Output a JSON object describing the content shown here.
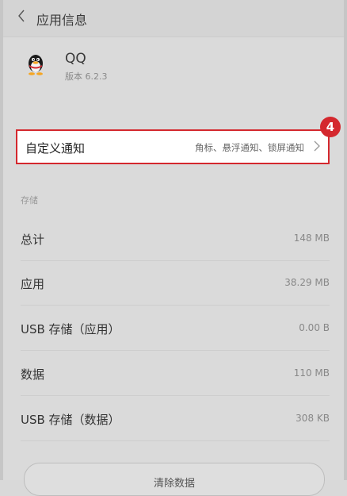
{
  "header": {
    "title": "应用信息"
  },
  "app": {
    "name": "QQ",
    "version": "版本 6.2.3"
  },
  "notification": {
    "label": "自定义通知",
    "value": "角标、悬浮通知、锁屏通知"
  },
  "badge": {
    "text": "4"
  },
  "storage": {
    "section_title": "存储",
    "rows": [
      {
        "label": "总计",
        "value": "148 MB"
      },
      {
        "label": "应用",
        "value": "38.29 MB"
      },
      {
        "label": "USB 存储（应用）",
        "value": "0.00 B"
      },
      {
        "label": "数据",
        "value": "110 MB"
      },
      {
        "label": "USB 存储（数据）",
        "value": "308 KB"
      }
    ]
  },
  "clear_button": {
    "label": "清除数据"
  },
  "colors": {
    "highlight": "#d4282e",
    "background": "#dadada"
  }
}
